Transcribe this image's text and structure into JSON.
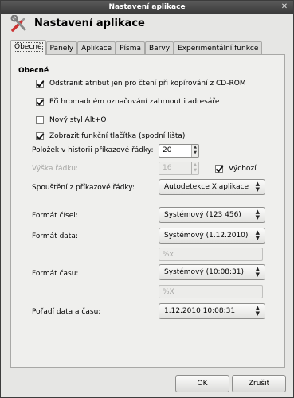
{
  "window": {
    "title": "Nastavení aplikace",
    "close": "✕"
  },
  "header": {
    "title": "Nastavení aplikace",
    "icon": "tools-icon"
  },
  "tabs": [
    {
      "label": "Obecné",
      "active": true
    },
    {
      "label": "Panely"
    },
    {
      "label": "Aplikace"
    },
    {
      "label": "Písma"
    },
    {
      "label": "Barvy"
    },
    {
      "label": "Experimentální funkce"
    }
  ],
  "general": {
    "section_title": "Obecné",
    "checkboxes": [
      {
        "label": "Odstranit atribut jen pro čtení při kopírování z CD-ROM",
        "checked": true
      },
      {
        "label": "Při hromadném označování zahrnout i adresáře",
        "checked": true
      },
      {
        "label": "Nový styl Alt+O",
        "checked": false
      },
      {
        "label": "Zobrazit funkční tlačítka (spodní lišta)",
        "checked": true
      }
    ],
    "history_label": "Položek v historii příkazové řádky:",
    "history_value": "20",
    "row_height_label": "Výška řádku:",
    "row_height_value": "16",
    "default_label": "Výchozí",
    "default_checked": true,
    "cmd_label": "Spouštění z příkazové řádky:",
    "cmd_value": "Autodetekce X aplikace",
    "number_format_label": "Formát čísel:",
    "number_format_value": "Systémový (123 456)",
    "date_format_label": "Formát data:",
    "date_format_value": "Systémový (1.12.2010)",
    "date_custom_value": "%x",
    "time_format_label": "Formát času:",
    "time_format_value": "Systémový (10:08:31)",
    "time_custom_value": "%X",
    "order_label": "Pořadí data a času:",
    "order_value": "1.12.2010 10:08:31"
  },
  "buttons": {
    "ok": "OK",
    "cancel": "Zrušit"
  }
}
